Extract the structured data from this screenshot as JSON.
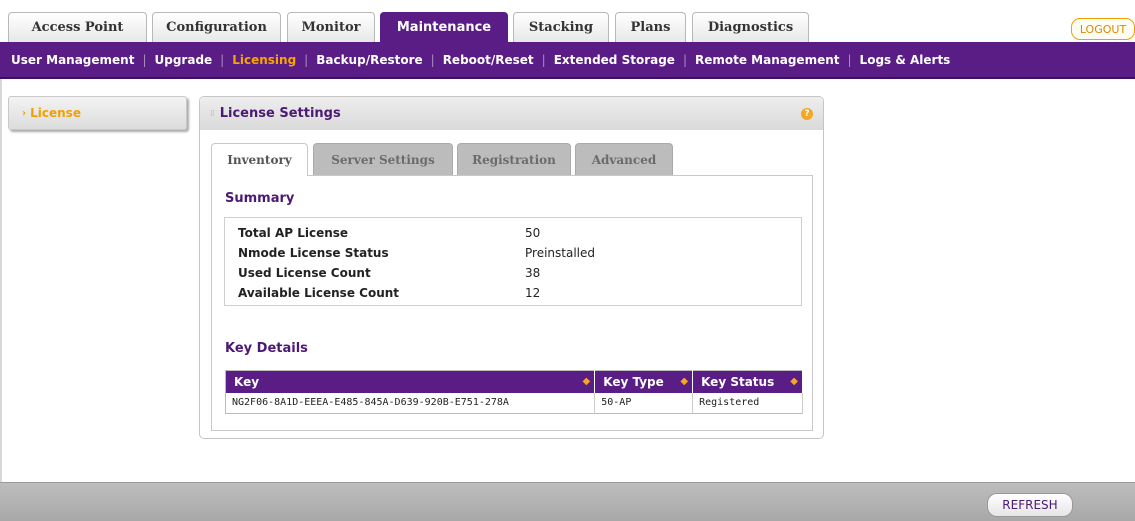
{
  "top_tabs": [
    {
      "label": "Access Point"
    },
    {
      "label": "Configuration"
    },
    {
      "label": "Monitor"
    },
    {
      "label": "Maintenance",
      "active": true
    },
    {
      "label": "Stacking"
    },
    {
      "label": "Plans"
    },
    {
      "label": "Diagnostics"
    }
  ],
  "logout_label": "LOGOUT",
  "sub_nav": [
    {
      "label": "User Management"
    },
    {
      "label": "Upgrade"
    },
    {
      "label": "Licensing",
      "active": true
    },
    {
      "label": "Backup/Restore"
    },
    {
      "label": "Reboot/Reset"
    },
    {
      "label": "Extended Storage"
    },
    {
      "label": "Remote Management"
    },
    {
      "label": "Logs & Alerts"
    }
  ],
  "left_menu": {
    "label": "License"
  },
  "panel": {
    "title": "License Settings",
    "help_glyph": "?",
    "tabs": [
      {
        "label": "Inventory",
        "active": true
      },
      {
        "label": "Server Settings"
      },
      {
        "label": "Registration"
      },
      {
        "label": "Advanced"
      }
    ],
    "summary": {
      "title": "Summary",
      "rows": [
        {
          "label": "Total AP License",
          "value": "50"
        },
        {
          "label": "Nmode License Status",
          "value": "Preinstalled"
        },
        {
          "label": "Used License Count",
          "value": "38"
        },
        {
          "label": "Available License Count",
          "value": "12"
        }
      ]
    },
    "key_details": {
      "title": "Key Details",
      "columns": [
        "Key",
        "Key Type",
        "Key Status"
      ],
      "rows": [
        {
          "key": "NG2F06-8A1D-EEEA-E485-845A-D639-920B-E751-278A",
          "type": "50-AP",
          "status": "Registered"
        }
      ]
    }
  },
  "refresh_label": "REFRESH",
  "colors": {
    "brand_purple": "#5a1d86",
    "accent_orange": "#f7a600"
  }
}
